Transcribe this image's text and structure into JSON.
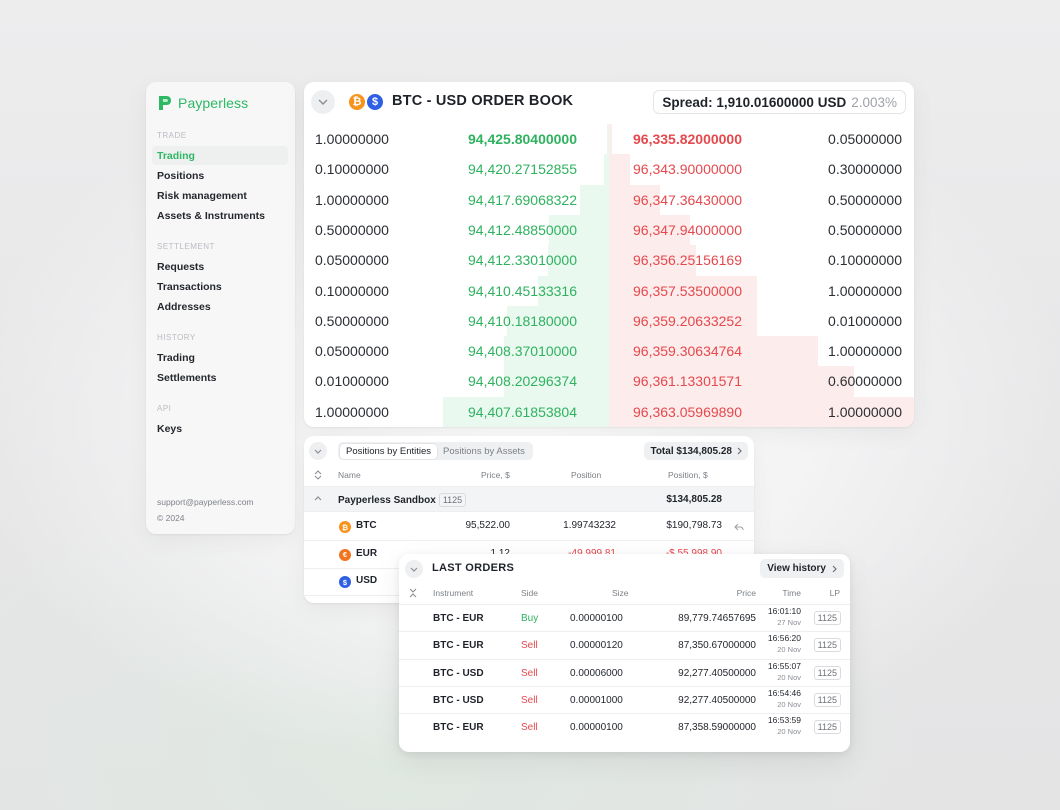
{
  "app": {
    "name": "Payperless"
  },
  "sidebar": {
    "sections": [
      {
        "title": "TRADE",
        "items": [
          "Trading",
          "Positions",
          "Risk management",
          "Assets & Instruments"
        ]
      },
      {
        "title": "SETTLEMENT",
        "items": [
          "Requests",
          "Transactions",
          "Addresses"
        ]
      },
      {
        "title": "HISTORY",
        "items": [
          "Trading",
          "Settlements"
        ]
      },
      {
        "title": "API",
        "items": [
          "Keys"
        ]
      }
    ],
    "active_item": "Trading",
    "support_email": "support@payperless.com",
    "copyright": "© 2024"
  },
  "order_book": {
    "title": "BTC - USD ORDER BOOK",
    "base_icon": "₿",
    "quote_icon": "$",
    "spread_label": "Spread: 1,910.01600000 USD",
    "spread_pct": "2.003%",
    "rows": [
      {
        "bid_size": "1.00000000",
        "bid": "94,425.80400000",
        "ask": "96,335.82000000",
        "ask_size": "0.05000000"
      },
      {
        "bid_size": "0.10000000",
        "bid": "94,420.27152855",
        "ask": "96,343.90000000",
        "ask_size": "0.30000000"
      },
      {
        "bid_size": "1.00000000",
        "bid": "94,417.69068322",
        "ask": "96,347.36430000",
        "ask_size": "0.50000000"
      },
      {
        "bid_size": "0.50000000",
        "bid": "94,412.48850000",
        "ask": "96,347.94000000",
        "ask_size": "0.50000000"
      },
      {
        "bid_size": "0.05000000",
        "bid": "94,412.33010000",
        "ask": "96,356.25156169",
        "ask_size": "0.10000000"
      },
      {
        "bid_size": "0.10000000",
        "bid": "94,410.45133316",
        "ask": "96,357.53500000",
        "ask_size": "1.00000000"
      },
      {
        "bid_size": "0.50000000",
        "bid": "94,410.18180000",
        "ask": "96,359.20633252",
        "ask_size": "0.01000000"
      },
      {
        "bid_size": "0.05000000",
        "bid": "94,408.37010000",
        "ask": "96,359.30634764",
        "ask_size": "1.00000000"
      },
      {
        "bid_size": "0.01000000",
        "bid": "94,408.20296374",
        "ask": "96,361.13301571",
        "ask_size": "0.60000000"
      },
      {
        "bid_size": "1.00000000",
        "bid": "94,407.61853804",
        "ask": "96,363.05969890",
        "ask_size": "1.00000000"
      }
    ],
    "bid_depth": [
      0.0,
      0.09,
      0.48,
      0.99,
      1.01,
      1.17,
      1.69,
      1.74,
      1.75,
      2.75
    ],
    "ask_depth": [
      0.05,
      0.35,
      0.85,
      1.35,
      1.45,
      2.45,
      2.46,
      3.46,
      4.06,
      5.06
    ],
    "colors": {
      "bid": "#2fb25f",
      "ask": "#e5484d",
      "bid_fill": "#e9f9ef",
      "ask_fill": "#fdecec"
    }
  },
  "positions": {
    "tabs": [
      "Positions by Entities",
      "Positions by Assets"
    ],
    "active_tab": "Positions by Entities",
    "total_label": "Total $134,805.28",
    "columns": [
      "Name",
      "Price, $",
      "Position",
      "Position, $"
    ],
    "group": {
      "name": "Payperless Sandbox",
      "badge": "1125",
      "value": "$134,805.28"
    },
    "rows": [
      {
        "icon": "₿",
        "asset": "BTC",
        "price": "95,522.00",
        "position": "1.99743232",
        "value": "$190,798.73"
      },
      {
        "icon": "€",
        "asset": "EUR",
        "price": "1.12",
        "position": "-49,999.81",
        "value": "-$ 55,998.90"
      },
      {
        "icon": "$",
        "asset": "USD",
        "price": "",
        "position": "",
        "value": ""
      }
    ]
  },
  "last_orders": {
    "title": "LAST ORDERS",
    "view_history": "View history",
    "columns": [
      "Instrument",
      "Side",
      "Size",
      "Price",
      "Time",
      "LP"
    ],
    "rows": [
      {
        "instrument": "BTC - EUR",
        "side": "Buy",
        "size": "0.00000100",
        "price": "89,779.74657695",
        "time": "16:01:10",
        "date": "27 Nov",
        "lp": "1125"
      },
      {
        "instrument": "BTC - EUR",
        "side": "Sell",
        "size": "0.00000120",
        "price": "87,350.67000000",
        "time": "16:56:20",
        "date": "20 Nov",
        "lp": "1125"
      },
      {
        "instrument": "BTC - USD",
        "side": "Sell",
        "size": "0.00006000",
        "price": "92,277.40500000",
        "time": "16:55:07",
        "date": "20 Nov",
        "lp": "1125"
      },
      {
        "instrument": "BTC - USD",
        "side": "Sell",
        "size": "0.00001000",
        "price": "92,277.40500000",
        "time": "16:54:46",
        "date": "20 Nov",
        "lp": "1125"
      },
      {
        "instrument": "BTC - EUR",
        "side": "Sell",
        "size": "0.00000100",
        "price": "87,358.59000000",
        "time": "16:53:59",
        "date": "20 Nov",
        "lp": "1125"
      }
    ]
  }
}
